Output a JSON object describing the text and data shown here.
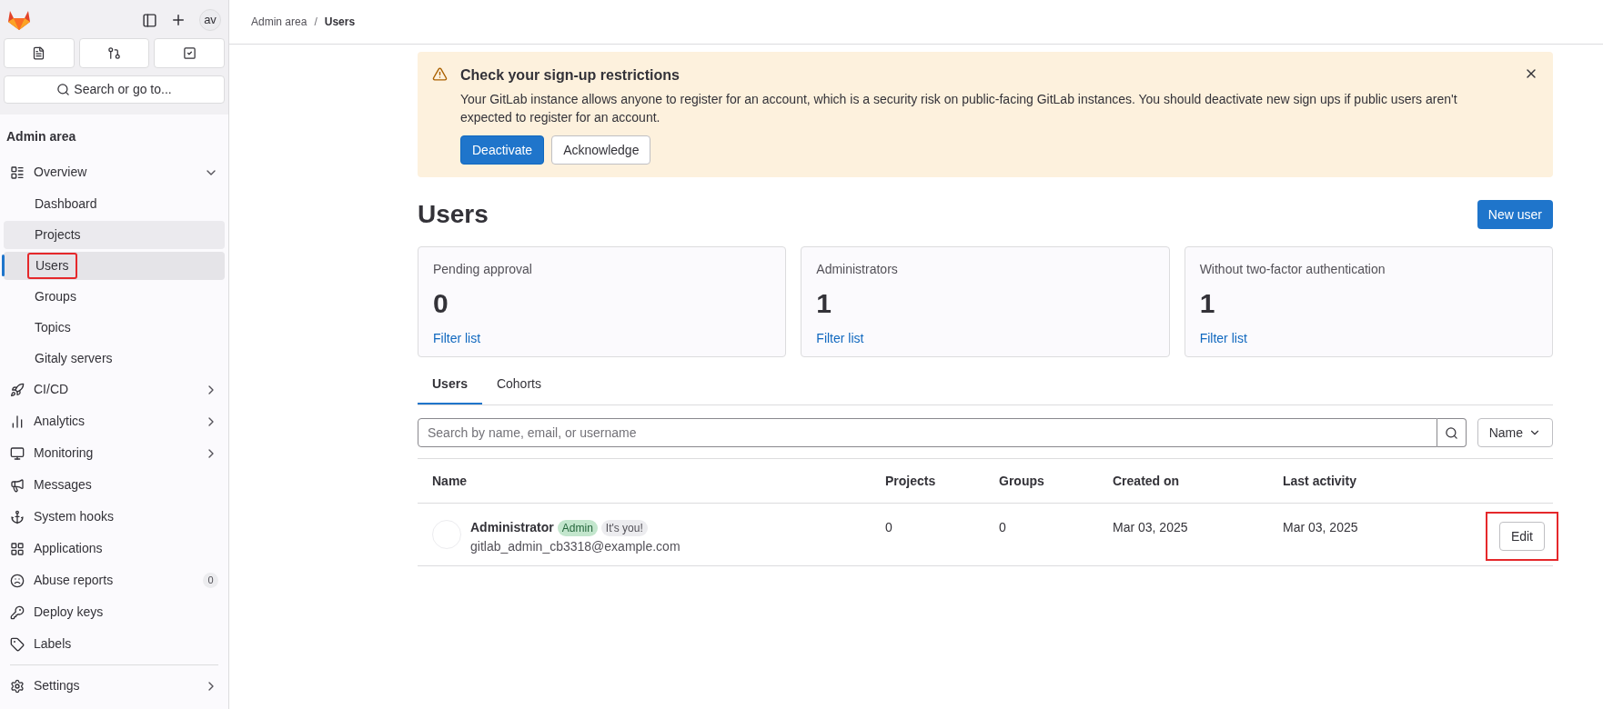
{
  "sidebar": {
    "avatar": "av",
    "search": {
      "placeholder": "Search or go to..."
    },
    "section_title": "Admin area",
    "items": [
      {
        "label": "Overview",
        "expanded": true,
        "children": [
          {
            "label": "Dashboard",
            "selected": false,
            "hovered": false,
            "annotated": false
          },
          {
            "label": "Projects",
            "selected": false,
            "hovered": true,
            "annotated": false
          },
          {
            "label": "Users",
            "selected": true,
            "hovered": false,
            "annotated": true
          },
          {
            "label": "Groups",
            "selected": false,
            "hovered": false,
            "annotated": false
          },
          {
            "label": "Topics",
            "selected": false,
            "hovered": false,
            "annotated": false
          },
          {
            "label": "Gitaly servers",
            "selected": false,
            "hovered": false,
            "annotated": false
          }
        ]
      },
      {
        "label": "CI/CD",
        "expanded": false
      },
      {
        "label": "Analytics",
        "expanded": false
      },
      {
        "label": "Monitoring",
        "expanded": false
      },
      {
        "label": "Messages"
      },
      {
        "label": "System hooks"
      },
      {
        "label": "Applications"
      },
      {
        "label": "Abuse reports",
        "badge": "0"
      },
      {
        "label": "Deploy keys"
      },
      {
        "label": "Labels"
      }
    ],
    "settings": {
      "label": "Settings",
      "expanded": false
    }
  },
  "breadcrumbs": [
    "Admin area",
    "Users"
  ],
  "breadcrumb_separator": "/",
  "alert": {
    "title": "Check your sign-up restrictions",
    "body": "Your GitLab instance allows anyone to register for an account, which is a security risk on public-facing GitLab instances. You should deactivate new sign ups if public users aren't expected to register for an account.",
    "buttons": [
      {
        "label": "Deactivate",
        "kind": "primary"
      },
      {
        "label": "Acknowledge",
        "kind": "default"
      }
    ]
  },
  "page_title": "Users",
  "new_button": "New user",
  "stats": [
    {
      "label": "Pending approval",
      "value": "0",
      "link": "Filter list"
    },
    {
      "label": "Administrators",
      "value": "1",
      "link": "Filter list"
    },
    {
      "label": "Without two-factor authentication",
      "value": "1",
      "link": "Filter list"
    }
  ],
  "tabs": [
    {
      "label": "Users",
      "selected": true
    },
    {
      "label": "Cohorts",
      "selected": false
    }
  ],
  "search": {
    "placeholder": "Search by name, email, or username"
  },
  "sort": "Name",
  "table": {
    "columns": [
      "Name",
      "Projects",
      "Groups",
      "Created on",
      "Last activity"
    ],
    "rows": [
      {
        "name": "Administrator",
        "badges": [
          {
            "label": "Admin",
            "kind": "success"
          },
          {
            "label": "It's you!",
            "kind": "neutral"
          }
        ],
        "email": "gitlab_admin_cb3318@example.com",
        "projects": "0",
        "groups": "0",
        "created": "Mar 03, 2025",
        "last_activity": "Mar 03, 2025",
        "action": {
          "label": "Edit",
          "annotated": true
        }
      }
    ]
  }
}
